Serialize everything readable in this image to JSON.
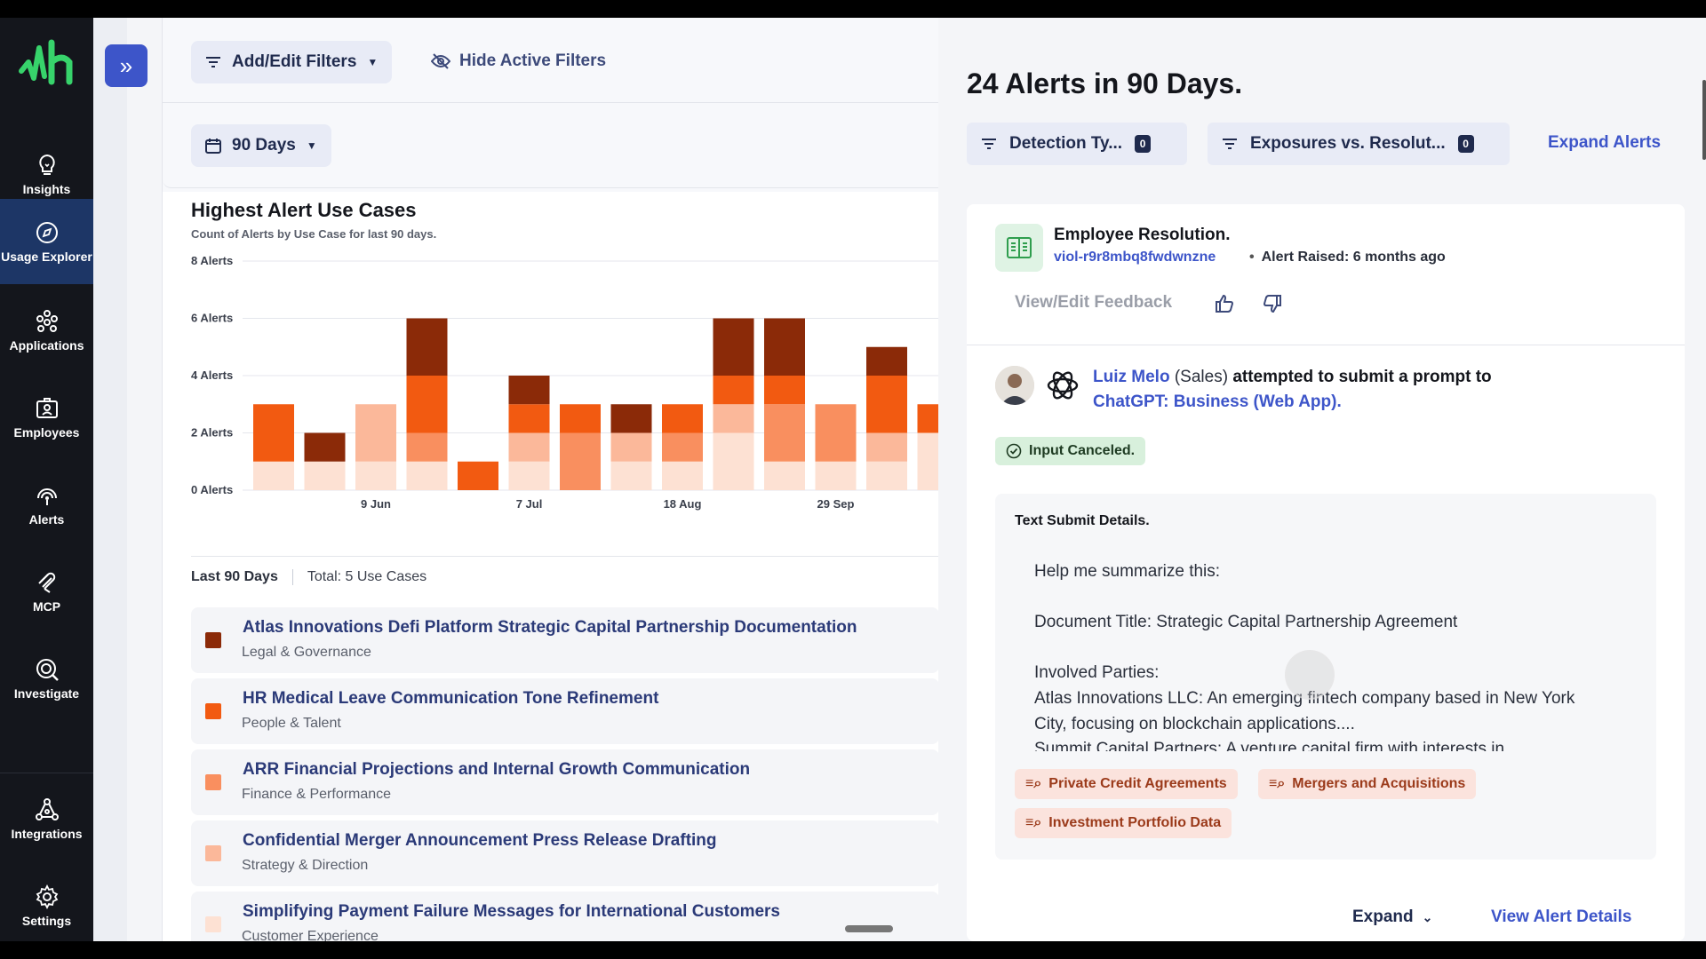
{
  "sidebar": {
    "items": [
      {
        "label": "Insights",
        "icon": "lightbulb-icon"
      },
      {
        "label": "Usage Explorer",
        "icon": "compass-icon"
      },
      {
        "label": "Applications",
        "icon": "apps-icon"
      },
      {
        "label": "Employees",
        "icon": "badge-icon"
      },
      {
        "label": "Alerts",
        "icon": "radar-icon"
      },
      {
        "label": "MCP",
        "icon": "mcp-icon"
      },
      {
        "label": "Investigate",
        "icon": "investigate-icon"
      },
      {
        "label": "Integrations",
        "icon": "integrations-icon"
      },
      {
        "label": "Settings",
        "icon": "gear-icon"
      }
    ],
    "active": "Usage Explorer"
  },
  "toolbar": {
    "filters_label": "Add/Edit Filters",
    "hide_filters_label": "Hide Active Filters",
    "date_range": "90 Days"
  },
  "chart_card": {
    "title": "Highest Alert Use Cases",
    "subtitle": "Count of Alerts by Use Case for last 90 days."
  },
  "chart_data": {
    "type": "bar",
    "stacked": true,
    "title": "Highest Alert Use Cases",
    "subtitle": "Count of Alerts by Use Case for last 90 days.",
    "y_ticks": [
      "0 Alerts",
      "2 Alerts",
      "4 Alerts",
      "6 Alerts",
      "8 Alerts"
    ],
    "ylim": [
      0,
      8
    ],
    "x_ticks": [
      "9 Jun",
      "7 Jul",
      "18 Aug",
      "29 Sep"
    ],
    "bars": [
      [
        0,
        2,
        0,
        0,
        1
      ],
      [
        1,
        0,
        0,
        0,
        1
      ],
      [
        0,
        0,
        0,
        2,
        1
      ],
      [
        2,
        2,
        1,
        0,
        1
      ],
      [
        0,
        1,
        0,
        0,
        0
      ],
      [
        1,
        1,
        0,
        1,
        1
      ],
      [
        0,
        1,
        2,
        0,
        0
      ],
      [
        1,
        0,
        0,
        1,
        1
      ],
      [
        0,
        1,
        1,
        0,
        1
      ],
      [
        2,
        1,
        0,
        1,
        2
      ],
      [
        2,
        1,
        2,
        0,
        1
      ],
      [
        0,
        0,
        2,
        0,
        1
      ],
      [
        1,
        2,
        0,
        1,
        1
      ],
      [
        0,
        1,
        0,
        0,
        2
      ]
    ],
    "colors": [
      "#8b2a08",
      "#f25a11",
      "#f98f5f",
      "#fbb89a",
      "#fde1d3"
    ],
    "grid": true
  },
  "use_cases": {
    "period_label": "Last 90 Days",
    "total_label": "Total: 5 Use Cases",
    "items": [
      {
        "title": "Atlas Innovations Defi Platform Strategic Capital Partnership Documentation",
        "category": "Legal & Governance",
        "color": "#8b2a08"
      },
      {
        "title": "HR Medical Leave Communication Tone Refinement",
        "category": "People & Talent",
        "color": "#f25a11"
      },
      {
        "title": "ARR Financial Projections and Internal Growth Communication",
        "category": "Finance & Performance",
        "color": "#f98f5f"
      },
      {
        "title": "Confidential Merger Announcement Press Release Drafting",
        "category": "Strategy & Direction",
        "color": "#fbb89a"
      },
      {
        "title": "Simplifying Payment Failure Messages for International Customers",
        "category": "Customer Experience",
        "color": "#fde1d3"
      }
    ]
  },
  "panel": {
    "title": "24 Alerts in 90 Days.",
    "filter1": {
      "label": "Detection Ty...",
      "count": "0"
    },
    "filter2": {
      "label": "Exposures vs. Resolut...",
      "count": "0"
    },
    "expand_alerts": "Expand Alerts"
  },
  "alert": {
    "resolution_title": "Employee Resolution.",
    "violation_id": "viol-r9r8mbq8fwdwnzne",
    "raised": "Alert Raised: 6 months ago",
    "feedback_label": "View/Edit Feedback",
    "user_name": "Luiz Melo",
    "department": "(Sales)",
    "action": "attempted to submit a prompt to",
    "app_name": "ChatGPT: Business (Web App).",
    "status": "Input Canceled.",
    "details_title": "Text Submit Details.",
    "details_text": "Help me summarize this:\n\nDocument Title: Strategic Capital Partnership Agreement\n\nInvolved Parties:\nAtlas Innovations LLC: An emerging fintech company based in New York City, focusing on blockchain applications....\nSummit Capital Partners: A venture capital firm with interests in",
    "tags": [
      "Private Credit Agreements",
      "Mergers and Acquisitions",
      "Investment Portfolio Data"
    ],
    "expand_label": "Expand",
    "view_details_label": "View Alert Details"
  }
}
